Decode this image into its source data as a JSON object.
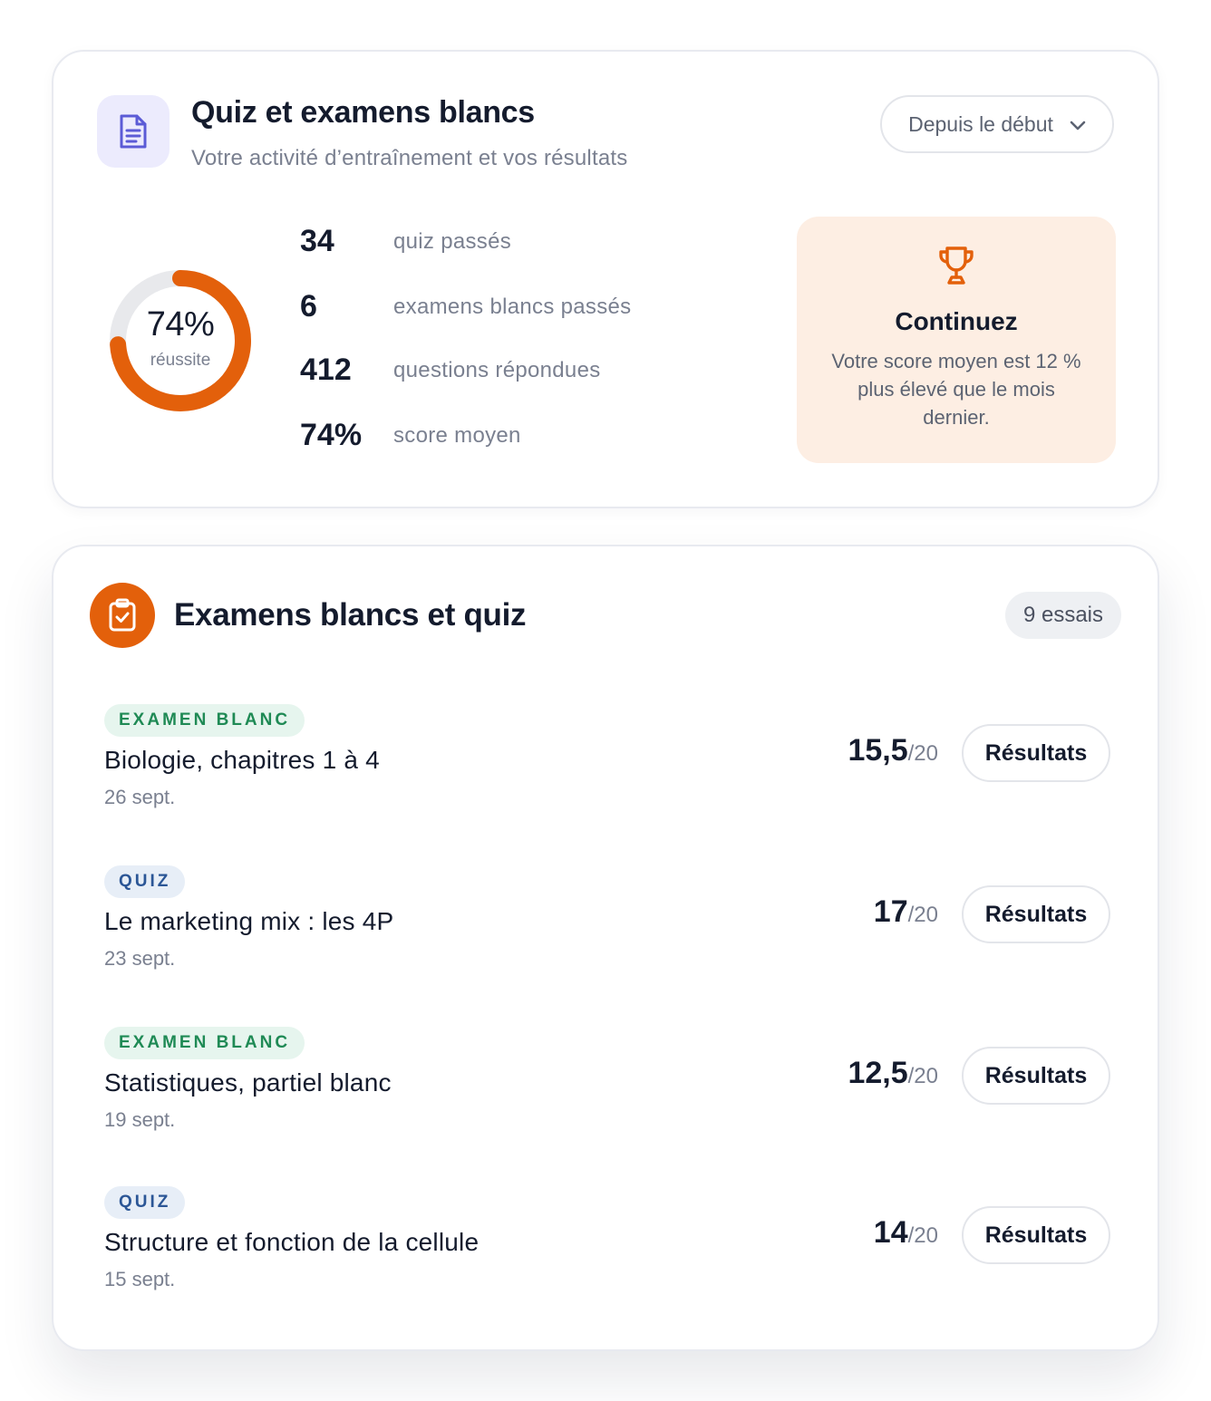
{
  "summary": {
    "title": "Quiz et examens blancs",
    "subtitle": "Votre activité d’entraînement et vos résultats",
    "range_select": "Depuis le début",
    "donut": {
      "value_label": "74%",
      "caption": "réussite",
      "fraction": 0.74,
      "color": "#e3600b",
      "track_color": "#e8e9ec"
    },
    "stats": [
      {
        "value": "34",
        "label": "quiz passés"
      },
      {
        "value": "6",
        "label": "examens blancs passés"
      },
      {
        "value": "412",
        "label": "questions répondues"
      },
      {
        "value": "74%",
        "label": "score moyen"
      }
    ],
    "promo": {
      "title": "Continuez",
      "text": "Votre score moyen est 12 % plus élevé que le mois dernier.",
      "icon": "trophy-icon"
    }
  },
  "attempts": {
    "title": "Examens blancs et quiz",
    "count_label": "9 essais",
    "items": [
      {
        "tag": "EXAMEN BLANC",
        "kind": "exam",
        "title": "Biologie, chapitres 1 à 4",
        "date": "26 sept.",
        "score": "15,5",
        "max": "/20",
        "button": "Résultats"
      },
      {
        "tag": "QUIZ",
        "kind": "quiz",
        "title": "Le marketing mix : les 4P",
        "date": "23 sept.",
        "score": "17",
        "max": "/20",
        "button": "Résultats"
      },
      {
        "tag": "EXAMEN BLANC",
        "kind": "exam",
        "title": "Statistiques, partiel blanc",
        "date": "19 sept.",
        "score": "12,5",
        "max": "/20",
        "button": "Résultats"
      },
      {
        "tag": "QUIZ",
        "kind": "quiz",
        "title": "Structure et fonction de la cellule",
        "date": "15 sept.",
        "score": "14",
        "max": "/20",
        "button": "Résultats"
      }
    ]
  },
  "colors": {
    "accent": "#e3600b",
    "exam_tag": "#1f8a55",
    "quiz_tag": "#2b5696",
    "doc_icon": "#5b5bd6"
  }
}
